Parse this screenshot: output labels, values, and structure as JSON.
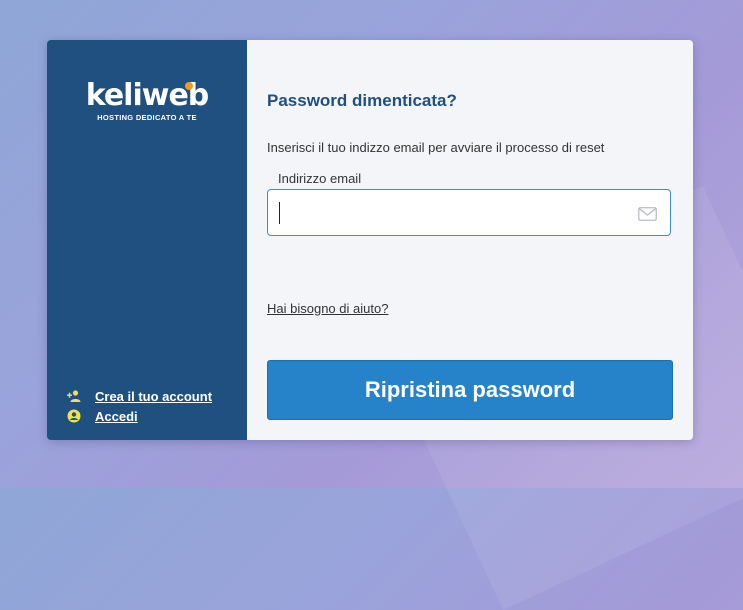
{
  "brand": {
    "logo_text": "keliweb",
    "tagline": "HOSTING DEDICATO A TE",
    "accent_color": "#f39a1f",
    "sidebar_color": "#20507f"
  },
  "sidebar": {
    "links": [
      {
        "label": "Crea il tuo account",
        "icon": "add-user-icon"
      },
      {
        "label": "Accedi",
        "icon": "user-circle-icon"
      }
    ]
  },
  "form": {
    "title": "Password dimenticata?",
    "description": "Inserisci il tuo indizzo email per avviare il processo di reset",
    "email_label": "Indirizzo email",
    "email_value": "",
    "email_icon": "mail-icon",
    "help_link": "Hai bisogno di aiuto?",
    "submit_label": "Ripristina password",
    "button_color": "#2683c9"
  }
}
